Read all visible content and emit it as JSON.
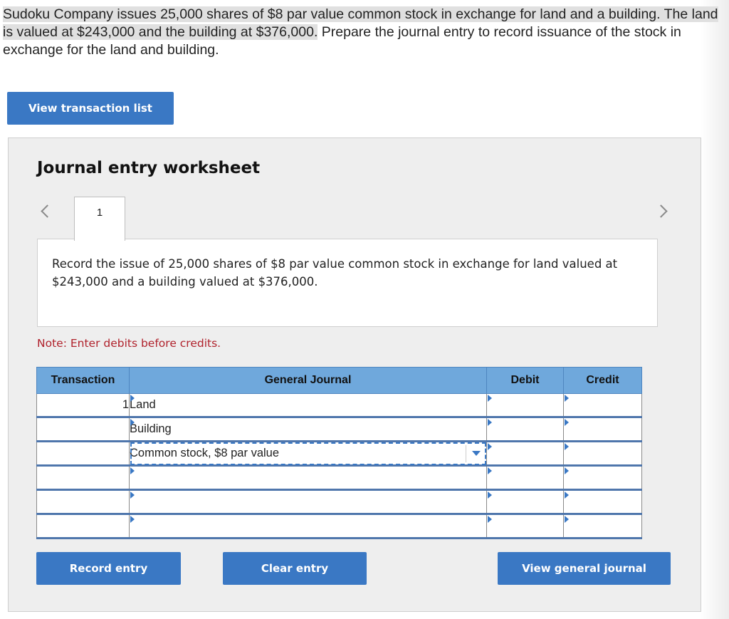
{
  "problem": {
    "text_highlighted": "Sudoku Company issues 25,000 shares of $8 par value common stock in exchange for land and a building. The land is valued at $243,000 and the building at $376,000.",
    "text_rest": " Prepare the journal entry to record issuance of the stock in exchange for the land and building."
  },
  "buttons": {
    "view_transaction_list": "View transaction list",
    "record_entry": "Record entry",
    "clear_entry": "Clear entry",
    "view_general_journal": "View general journal"
  },
  "worksheet": {
    "title": "Journal entry worksheet",
    "tab_number": "1",
    "description": "Record the issue of 25,000 shares of $8 par value common stock in exchange for land valued at $243,000 and a building valued at $376,000.",
    "note": "Note: Enter debits before credits."
  },
  "journal": {
    "headers": {
      "transaction": "Transaction",
      "general_journal": "General Journal",
      "debit": "Debit",
      "credit": "Credit"
    },
    "rows": [
      {
        "transaction": "1",
        "account": "Land",
        "debit": "",
        "credit": ""
      },
      {
        "transaction": "",
        "account": "Building",
        "debit": "",
        "credit": ""
      },
      {
        "transaction": "",
        "account": "Common stock, $8 par value",
        "debit": "",
        "credit": ""
      },
      {
        "transaction": "",
        "account": "",
        "debit": "",
        "credit": ""
      },
      {
        "transaction": "",
        "account": "",
        "debit": "",
        "credit": ""
      },
      {
        "transaction": "",
        "account": "",
        "debit": "",
        "credit": ""
      }
    ]
  },
  "icons": {
    "prev": "chevron-left-icon",
    "next": "chevron-right-icon",
    "dropdown": "caret-down-icon",
    "field_marker": "field-marker-icon"
  },
  "colors": {
    "accent": "#3a78c4",
    "header_bg": "#6fa8dc",
    "note": "#b0222c"
  }
}
